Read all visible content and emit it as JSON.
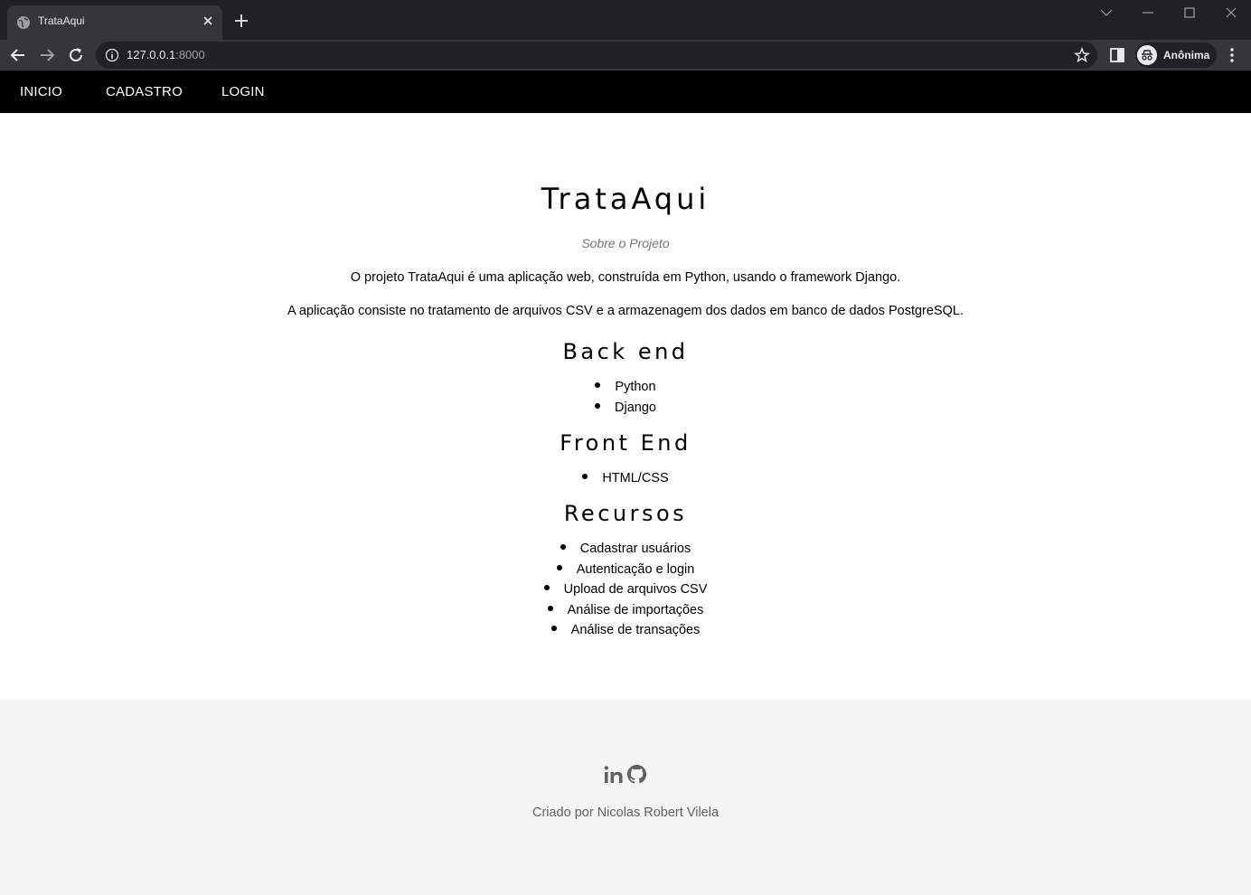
{
  "browser": {
    "tab_title": "TrataAqui",
    "url_host": "127.0.0.1",
    "url_port": ":8000",
    "profile_label": "Anônima"
  },
  "navbar": {
    "items": [
      "INICIO",
      "CADASTRO",
      "LOGIN"
    ]
  },
  "main": {
    "title": "TrataAqui",
    "subtitle": "Sobre o Projeto",
    "paragraphs": [
      "O projeto TrataAqui é uma aplicação web, construída em Python, usando o framework Django.",
      "A aplicação consiste no tratamento de arquivos CSV e a armazenagem dos dados em banco de dados PostgreSQL."
    ],
    "sections": [
      {
        "title": "Back end",
        "items": [
          "Python",
          "Django"
        ]
      },
      {
        "title": "Front End",
        "items": [
          "HTML/CSS"
        ]
      },
      {
        "title": "Recursos",
        "items": [
          "Cadastrar usuários",
          "Autenticação e login",
          "Upload de arquivos CSV",
          "Análise de importações",
          "Análise de transações"
        ]
      }
    ]
  },
  "footer": {
    "credit": "Criado por Nicolas Robert Vilela",
    "social_icons": [
      "linkedin-icon",
      "github-icon"
    ]
  },
  "colors": {
    "navbar_bg": "#000000",
    "footer_bg": "#f5f5f5",
    "chrome_dark": "#202124",
    "chrome_toolbar": "#35363a"
  }
}
